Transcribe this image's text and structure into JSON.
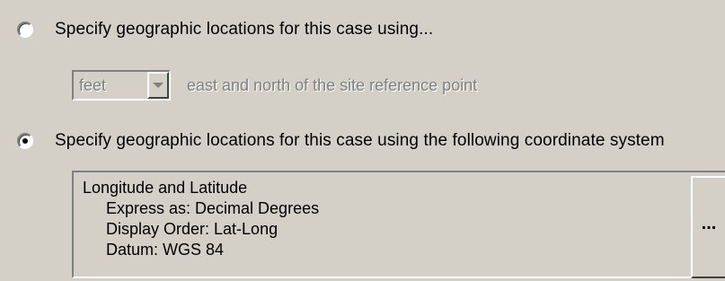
{
  "options": [
    {
      "id": "relative",
      "label": "Specify geographic locations for this case using...",
      "selected": false
    },
    {
      "id": "coordinate-system",
      "label": "Specify geographic locations for this case using the following coordinate system",
      "selected": true
    }
  ],
  "relative": {
    "units_value": "feet",
    "description": "east and north of the site reference point"
  },
  "coordinate_system": {
    "name": "Longitude and Latitude",
    "details": [
      "Express as: Decimal Degrees",
      "Display Order: Lat-Long",
      "Datum: WGS 84"
    ],
    "browse_label": "..."
  },
  "icons": {
    "dropdown": "chevron-down-icon"
  }
}
